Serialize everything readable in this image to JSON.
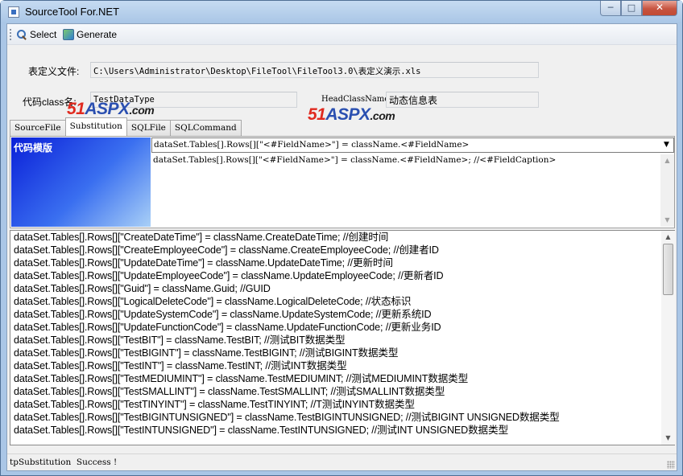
{
  "window": {
    "title": "SourceTool For.NET",
    "minimize_glyph": "─",
    "maximize_glyph": "□",
    "close_glyph": "✕"
  },
  "toolbar": {
    "select_label": "Select",
    "generate_label": "Generate"
  },
  "form": {
    "definition_file_label": "表定义文件:",
    "definition_file_value": "C:\\Users\\Administrator\\Desktop\\FileTool\\FileTool3.0\\表定义演示.xls",
    "class_name_label": "代码class名:",
    "class_name_value": "TestDataType",
    "head_class_label": "HeadClassName",
    "head_class_value": "动态信息表"
  },
  "watermarks": [
    {
      "num": "51",
      "brand": "ASPX",
      "suffix": ".com"
    },
    {
      "num": "51",
      "brand": "ASPX",
      "suffix": ".com"
    }
  ],
  "tabs": [
    {
      "label": "SourceFile",
      "active": false
    },
    {
      "label": "Substitution",
      "active": true
    },
    {
      "label": "SQLFile",
      "active": false
    },
    {
      "label": "SQLCommand",
      "active": false
    }
  ],
  "substitution": {
    "template_title": "代码模版",
    "template_selected": "dataSet.Tables[].Rows[][\"<#FieldName>\"] = className.<#FieldName>",
    "template_text": "dataSet.Tables[].Rows[][\"<#FieldName>\"] = className.<#FieldName>; //<#FieldCaption>"
  },
  "output": {
    "lines": [
      "dataSet.Tables[].Rows[][\"CreateDateTime\"] = className.CreateDateTime; //创建时间",
      "dataSet.Tables[].Rows[][\"CreateEmployeeCode\"] = className.CreateEmployeeCode; //创建者ID",
      "dataSet.Tables[].Rows[][\"UpdateDateTime\"] = className.UpdateDateTime; //更新时间",
      "dataSet.Tables[].Rows[][\"UpdateEmployeeCode\"] = className.UpdateEmployeeCode; //更新者ID",
      "dataSet.Tables[].Rows[][\"Guid\"] = className.Guid; //GUID",
      "dataSet.Tables[].Rows[][\"LogicalDeleteCode\"] = className.LogicalDeleteCode; //状态标识",
      "dataSet.Tables[].Rows[][\"UpdateSystemCode\"] = className.UpdateSystemCode; //更新系统ID",
      "dataSet.Tables[].Rows[][\"UpdateFunctionCode\"] = className.UpdateFunctionCode; //更新业务ID",
      "dataSet.Tables[].Rows[][\"TestBIT\"] = className.TestBIT; //测试BIT数据类型",
      "dataSet.Tables[].Rows[][\"TestBIGINT\"] = className.TestBIGINT; //测试BIGINT数据类型",
      "dataSet.Tables[].Rows[][\"TestINT\"] = className.TestINT; //测试INT数据类型",
      "dataSet.Tables[].Rows[][\"TestMEDIUMINT\"] = className.TestMEDIUMINT; //测试MEDIUMINT数据类型",
      "dataSet.Tables[].Rows[][\"TestSMALLINT\"] = className.TestSMALLINT; //测试SMALLINT数据类型",
      "dataSet.Tables[].Rows[][\"TestTINYINT\"] = className.TestTINYINT; //T测试INYINT数据类型",
      "dataSet.Tables[].Rows[][\"TestBIGINTUNSIGNED\"] = className.TestBIGINTUNSIGNED; //测试BIGINT UNSIGNED数据类型",
      "dataSet.Tables[].Rows[][\"TestINTUNSIGNED\"] = className.TestINTUNSIGNED; //测试INT UNSIGNED数据类型"
    ]
  },
  "status": {
    "text": "tpSubstitution  Success !"
  },
  "icons": {
    "select": "magnifier-icon",
    "generate": "generate-icon",
    "scroll_up": "▲",
    "scroll_down": "▼",
    "combo_arrow": "▼"
  }
}
